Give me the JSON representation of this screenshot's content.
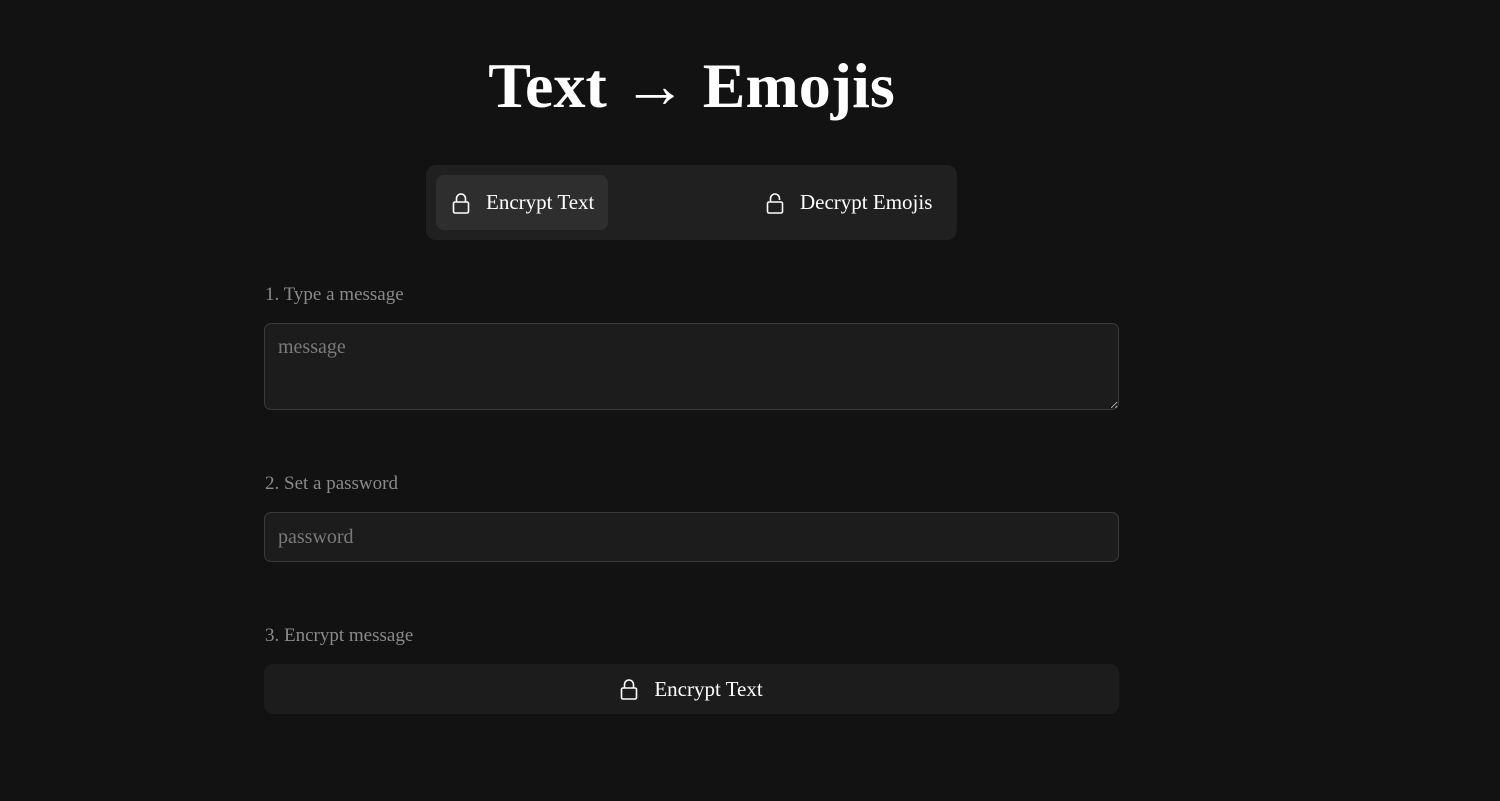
{
  "header": {
    "title": "Text → Emojis"
  },
  "tabs": [
    {
      "label": "Encrypt Text",
      "icon": "lock-icon",
      "active": true
    },
    {
      "label": "Decrypt Emojis",
      "icon": "unlock-icon",
      "active": false
    }
  ],
  "steps": {
    "message_label": "1. Type a message",
    "message_placeholder": "message",
    "password_label": "2. Set a password",
    "password_placeholder": "password",
    "encrypt_label": "3. Encrypt message"
  },
  "action": {
    "button_label": "Encrypt Text",
    "icon": "lock-icon"
  },
  "colors": {
    "background": "#121212",
    "panel": "#202020",
    "active_tab": "#2e2e2e",
    "input_bg": "#1c1c1c",
    "muted_text": "#8a8a8a"
  }
}
